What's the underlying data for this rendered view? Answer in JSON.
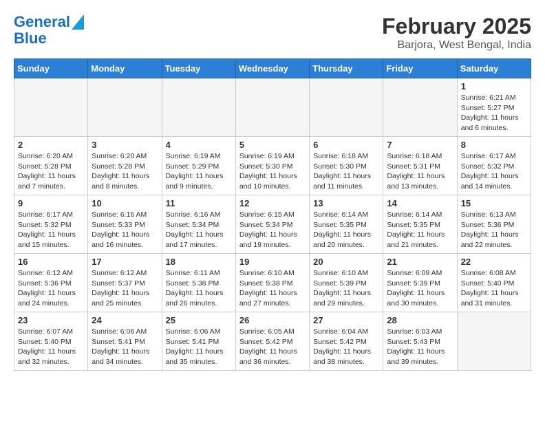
{
  "logo": {
    "line1": "General",
    "line2": "Blue"
  },
  "title": "February 2025",
  "subtitle": "Barjora, West Bengal, India",
  "weekdays": [
    "Sunday",
    "Monday",
    "Tuesday",
    "Wednesday",
    "Thursday",
    "Friday",
    "Saturday"
  ],
  "weeks": [
    [
      {
        "day": "",
        "detail": ""
      },
      {
        "day": "",
        "detail": ""
      },
      {
        "day": "",
        "detail": ""
      },
      {
        "day": "",
        "detail": ""
      },
      {
        "day": "",
        "detail": ""
      },
      {
        "day": "",
        "detail": ""
      },
      {
        "day": "1",
        "detail": "Sunrise: 6:21 AM\nSunset: 5:27 PM\nDaylight: 11 hours and 6 minutes."
      }
    ],
    [
      {
        "day": "2",
        "detail": "Sunrise: 6:20 AM\nSunset: 5:28 PM\nDaylight: 11 hours and 7 minutes."
      },
      {
        "day": "3",
        "detail": "Sunrise: 6:20 AM\nSunset: 5:28 PM\nDaylight: 11 hours and 8 minutes."
      },
      {
        "day": "4",
        "detail": "Sunrise: 6:19 AM\nSunset: 5:29 PM\nDaylight: 11 hours and 9 minutes."
      },
      {
        "day": "5",
        "detail": "Sunrise: 6:19 AM\nSunset: 5:30 PM\nDaylight: 11 hours and 10 minutes."
      },
      {
        "day": "6",
        "detail": "Sunrise: 6:18 AM\nSunset: 5:30 PM\nDaylight: 11 hours and 11 minutes."
      },
      {
        "day": "7",
        "detail": "Sunrise: 6:18 AM\nSunset: 5:31 PM\nDaylight: 11 hours and 13 minutes."
      },
      {
        "day": "8",
        "detail": "Sunrise: 6:17 AM\nSunset: 5:32 PM\nDaylight: 11 hours and 14 minutes."
      }
    ],
    [
      {
        "day": "9",
        "detail": "Sunrise: 6:17 AM\nSunset: 5:32 PM\nDaylight: 11 hours and 15 minutes."
      },
      {
        "day": "10",
        "detail": "Sunrise: 6:16 AM\nSunset: 5:33 PM\nDaylight: 11 hours and 16 minutes."
      },
      {
        "day": "11",
        "detail": "Sunrise: 6:16 AM\nSunset: 5:34 PM\nDaylight: 11 hours and 17 minutes."
      },
      {
        "day": "12",
        "detail": "Sunrise: 6:15 AM\nSunset: 5:34 PM\nDaylight: 11 hours and 19 minutes."
      },
      {
        "day": "13",
        "detail": "Sunrise: 6:14 AM\nSunset: 5:35 PM\nDaylight: 11 hours and 20 minutes."
      },
      {
        "day": "14",
        "detail": "Sunrise: 6:14 AM\nSunset: 5:35 PM\nDaylight: 11 hours and 21 minutes."
      },
      {
        "day": "15",
        "detail": "Sunrise: 6:13 AM\nSunset: 5:36 PM\nDaylight: 11 hours and 22 minutes."
      }
    ],
    [
      {
        "day": "16",
        "detail": "Sunrise: 6:12 AM\nSunset: 5:36 PM\nDaylight: 11 hours and 24 minutes."
      },
      {
        "day": "17",
        "detail": "Sunrise: 6:12 AM\nSunset: 5:37 PM\nDaylight: 11 hours and 25 minutes."
      },
      {
        "day": "18",
        "detail": "Sunrise: 6:11 AM\nSunset: 5:38 PM\nDaylight: 11 hours and 26 minutes."
      },
      {
        "day": "19",
        "detail": "Sunrise: 6:10 AM\nSunset: 5:38 PM\nDaylight: 11 hours and 27 minutes."
      },
      {
        "day": "20",
        "detail": "Sunrise: 6:10 AM\nSunset: 5:39 PM\nDaylight: 11 hours and 29 minutes."
      },
      {
        "day": "21",
        "detail": "Sunrise: 6:09 AM\nSunset: 5:39 PM\nDaylight: 11 hours and 30 minutes."
      },
      {
        "day": "22",
        "detail": "Sunrise: 6:08 AM\nSunset: 5:40 PM\nDaylight: 11 hours and 31 minutes."
      }
    ],
    [
      {
        "day": "23",
        "detail": "Sunrise: 6:07 AM\nSunset: 5:40 PM\nDaylight: 11 hours and 32 minutes."
      },
      {
        "day": "24",
        "detail": "Sunrise: 6:06 AM\nSunset: 5:41 PM\nDaylight: 11 hours and 34 minutes."
      },
      {
        "day": "25",
        "detail": "Sunrise: 6:06 AM\nSunset: 5:41 PM\nDaylight: 11 hours and 35 minutes."
      },
      {
        "day": "26",
        "detail": "Sunrise: 6:05 AM\nSunset: 5:42 PM\nDaylight: 11 hours and 36 minutes."
      },
      {
        "day": "27",
        "detail": "Sunrise: 6:04 AM\nSunset: 5:42 PM\nDaylight: 11 hours and 38 minutes."
      },
      {
        "day": "28",
        "detail": "Sunrise: 6:03 AM\nSunset: 5:43 PM\nDaylight: 11 hours and 39 minutes."
      },
      {
        "day": "",
        "detail": ""
      }
    ]
  ]
}
